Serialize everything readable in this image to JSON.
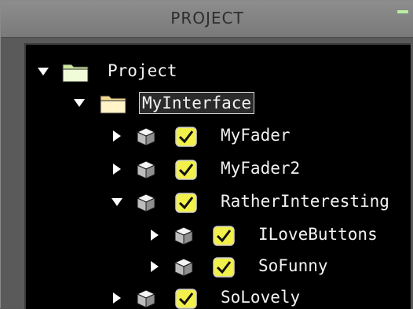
{
  "panel": {
    "title": "PROJECT",
    "minimize_icon": "minimize-icon"
  },
  "tree": {
    "root": {
      "label": "Project",
      "expanded": true,
      "icon": "folder-open-icon"
    },
    "interface": {
      "label": "MyInterface",
      "expanded": true,
      "selected": true,
      "icon": "folder-open-icon"
    },
    "items": [
      {
        "label": "MyFader",
        "expanded": false,
        "checked": true,
        "icon": "cube-icon"
      },
      {
        "label": "MyFader2",
        "expanded": false,
        "checked": true,
        "icon": "cube-icon"
      },
      {
        "label": "RatherInteresting",
        "expanded": true,
        "checked": true,
        "icon": "cube-icon"
      },
      {
        "label": "ILoveButtons",
        "expanded": false,
        "checked": true,
        "icon": "cube-icon"
      },
      {
        "label": "SoFunny",
        "expanded": false,
        "checked": true,
        "icon": "cube-icon"
      },
      {
        "label": "SoLovely",
        "expanded": false,
        "checked": true,
        "icon": "cube-icon"
      }
    ]
  },
  "colors": {
    "folder": "#e8f5c8",
    "check_fill": "#f2f04a",
    "text": "#f2f2f2",
    "accent": "#b8f0a0"
  }
}
